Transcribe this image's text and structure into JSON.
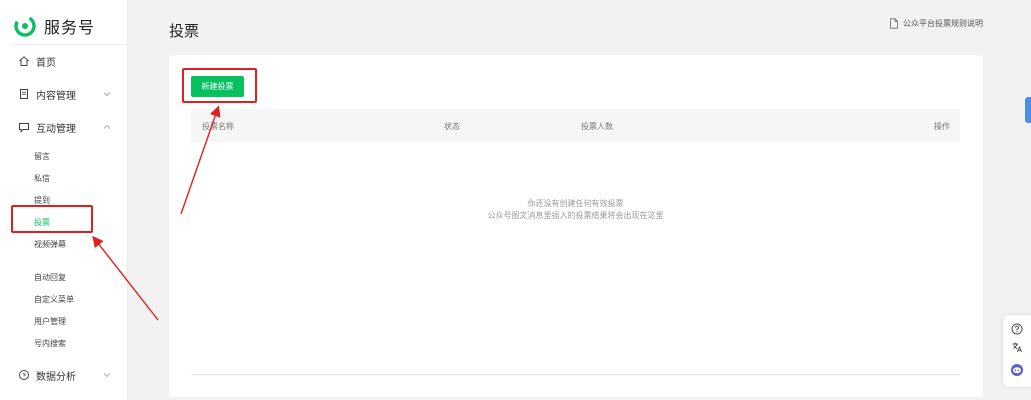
{
  "brand": {
    "name": "服务号",
    "color": "#07c160"
  },
  "nav": {
    "home": "首页",
    "content": "内容管理",
    "interaction": "互动管理",
    "sub_interaction": [
      "留言",
      "私信",
      "提到",
      "投票",
      "视频弹幕"
    ],
    "sub_functions": [
      "自动回复",
      "自定义菜单",
      "用户管理",
      "号内搜索"
    ],
    "analytics": "数据分析"
  },
  "page": {
    "title": "投票",
    "help_link": "公众平台投票规则说明",
    "new_button": "新建投票"
  },
  "table": {
    "columns": [
      "投票名称",
      "状态",
      "投票人数",
      "操作"
    ],
    "empty_line1": "你还没有创建任何有效投票",
    "empty_line2": "公众号图文消息里插入的投票结果将会出现在这里"
  },
  "colors": {
    "accent": "#07c160",
    "highlight": "#e02020"
  },
  "icons": [
    "home-icon",
    "document-icon",
    "chat-icon",
    "chevron-down-icon",
    "chevron-up-icon",
    "clock-icon",
    "file-icon",
    "help-icon",
    "translate-icon",
    "assistant-icon"
  ]
}
